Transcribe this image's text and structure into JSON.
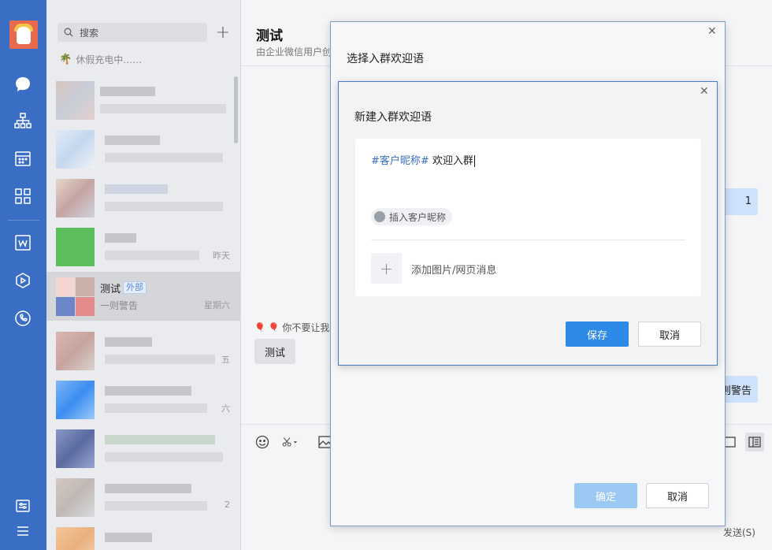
{
  "sidebar": {
    "icons": [
      "avatar",
      "chat-icon",
      "org-icon",
      "calendar-icon",
      "apps-icon",
      "doc-icon",
      "cube-icon",
      "phone-icon",
      "settings-icon",
      "menu-icon"
    ]
  },
  "chat_list": {
    "search_placeholder": "搜索",
    "status_text": "休假充电中……",
    "items": [
      {
        "name": "",
        "preview": "",
        "time": ""
      },
      {
        "name": "",
        "preview": "",
        "time": ""
      },
      {
        "name": "",
        "preview": "",
        "time": ""
      },
      {
        "name": "",
        "preview": "",
        "time": "昨天"
      },
      {
        "name": "测试",
        "tag": "外部",
        "preview": "一则警告",
        "time": "星期六"
      },
      {
        "name": "",
        "preview": "",
        "time": "五"
      },
      {
        "name": "",
        "preview": "",
        "time": "六"
      },
      {
        "name": "",
        "preview": "",
        "time": ""
      },
      {
        "name": "",
        "preview": "",
        "time": "2"
      }
    ]
  },
  "main": {
    "title": "测试",
    "subtitle": "由企业微信用户创",
    "bubble_right1": "1",
    "bubble_right2": "则警告",
    "system_text": "你不要让我",
    "test_button": "测试",
    "send_label": "发送(S)"
  },
  "outer_dialog": {
    "title": "选择入群欢迎语",
    "confirm": "确定",
    "cancel": "取消"
  },
  "inner_dialog": {
    "title": "新建入群欢迎语",
    "token": "#客户昵称#",
    "text": " 欢迎入群",
    "insert_chip": "插入客户昵称",
    "add_media": "添加图片/网页消息",
    "save": "保存",
    "cancel": "取消"
  },
  "colors": {
    "nav_bg": "#3a6dc4",
    "primary": "#2d8ae6",
    "primary_disabled": "#9cc8f4",
    "token": "#3a6dc4"
  }
}
